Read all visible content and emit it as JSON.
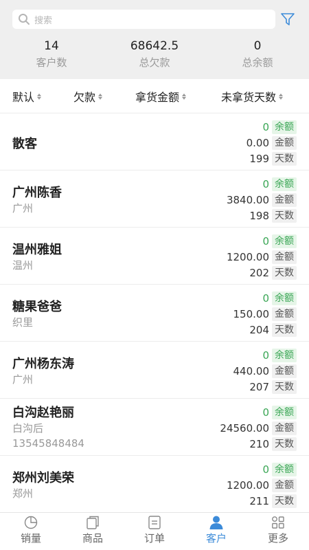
{
  "search": {
    "placeholder": "搜索"
  },
  "stats": [
    {
      "value": "14",
      "label": "客户数"
    },
    {
      "value": "68642.5",
      "label": "总欠款"
    },
    {
      "value": "0",
      "label": "总余额"
    }
  ],
  "sort": [
    {
      "label": "默认"
    },
    {
      "label": "欠款"
    },
    {
      "label": "拿货金额"
    },
    {
      "label": "未拿货天数"
    }
  ],
  "tag_labels": {
    "balance": "余额",
    "amount": "金额",
    "days": "天数"
  },
  "customers": [
    {
      "name": "散客",
      "sub": "",
      "phone": "",
      "balance": "0",
      "amount": "0.00",
      "days": "199"
    },
    {
      "name": "广州陈香",
      "sub": "广州",
      "phone": "",
      "balance": "0",
      "amount": "3840.00",
      "days": "198"
    },
    {
      "name": "温州雅姐",
      "sub": "温州",
      "phone": "",
      "balance": "0",
      "amount": "1200.00",
      "days": "202"
    },
    {
      "name": "糖果爸爸",
      "sub": "织里",
      "phone": "",
      "balance": "0",
      "amount": "150.00",
      "days": "204"
    },
    {
      "name": "广州杨东涛",
      "sub": "广州",
      "phone": "",
      "balance": "0",
      "amount": "440.00",
      "days": "207"
    },
    {
      "name": "白沟赵艳丽",
      "sub": "白沟后",
      "phone": "13545848484",
      "balance": "0",
      "amount": "24560.00",
      "days": "210"
    },
    {
      "name": "郑州刘美荣",
      "sub": "郑州",
      "phone": "",
      "balance": "0",
      "amount": "1200.00",
      "days": "211"
    }
  ],
  "tabs": [
    {
      "label": "销量",
      "icon": "pie-chart-icon",
      "active": false
    },
    {
      "label": "商品",
      "icon": "copy-icon",
      "active": false
    },
    {
      "label": "订单",
      "icon": "document-icon",
      "active": false
    },
    {
      "label": "客户",
      "icon": "user-icon",
      "active": true
    },
    {
      "label": "更多",
      "icon": "grid-icon",
      "active": false
    }
  ],
  "colors": {
    "accent": "#3c8bd9",
    "green": "#3aa655"
  }
}
